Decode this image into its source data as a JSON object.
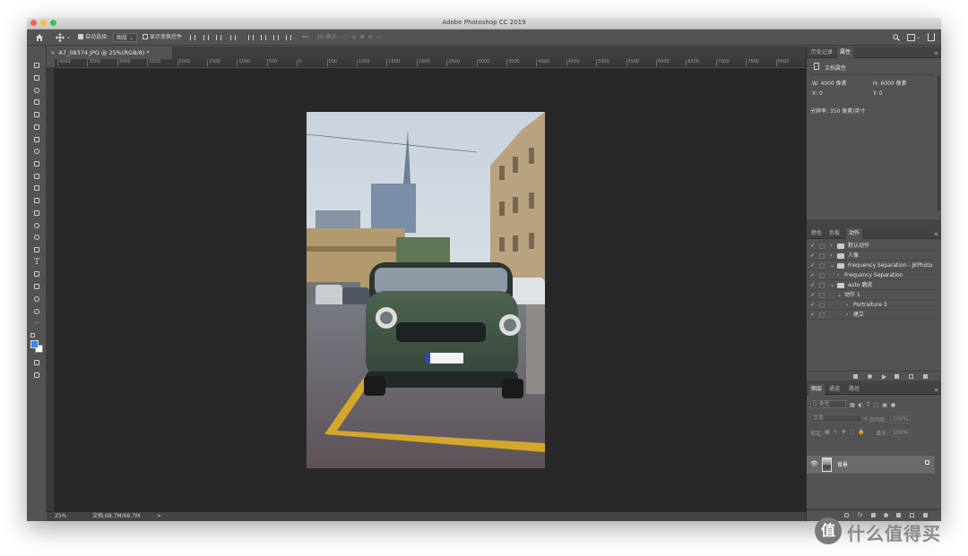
{
  "window": {
    "title": "Adobe Photoshop CC 2019"
  },
  "options_bar": {
    "auto_select_label": "自动选择:",
    "auto_select_value": "图层",
    "show_transform_label": "显示变换控件",
    "mode_3d_label": "3D 模式:"
  },
  "document": {
    "tab_label": "A7_08374.JPG @ 25%(RGB/8) *"
  },
  "rulers": {
    "top_ticks": [
      "4000",
      "3500",
      "3000",
      "2500",
      "2000",
      "1500",
      "1000",
      "500",
      "0",
      "500",
      "1000",
      "1500",
      "2000",
      "2500",
      "3000",
      "3500",
      "4000",
      "4500",
      "5000",
      "5500",
      "6000",
      "6500",
      "7000",
      "7500",
      "8000"
    ]
  },
  "status": {
    "zoom": "25%",
    "doc_info": "文档:68.7M/68.7M",
    "arrow": ">"
  },
  "panels": {
    "top": {
      "tabs": [
        "历史记录",
        "属性"
      ],
      "active_tab": "属性",
      "section_label": "文档属性",
      "width": "W: 4000 像素",
      "height": "H: 6000 像素",
      "x": "X: 0",
      "y": "Y: 0",
      "resolution": "分辨率: 350 像素/英寸"
    },
    "middle": {
      "tabs": [
        "颜色",
        "色板",
        "动作"
      ],
      "active_tab": "动作",
      "actions": [
        {
          "label": "默认动作",
          "type": "set",
          "expanded": false
        },
        {
          "label": "人像",
          "type": "set",
          "expanded": false
        },
        {
          "label": "Frequency Separation - JKPhoto",
          "type": "set",
          "expanded": true
        },
        {
          "label": "Frequency Separation",
          "type": "action",
          "expanded": false
        },
        {
          "label": "auto 磨皮",
          "type": "set",
          "expanded": true
        },
        {
          "label": "动作 1",
          "type": "action",
          "expanded": true
        },
        {
          "label": "Portraiture 3",
          "type": "step",
          "expanded": false
        },
        {
          "label": "建立",
          "type": "step",
          "expanded": false
        }
      ]
    },
    "bottom": {
      "tabs": [
        "图层",
        "通道",
        "路径"
      ],
      "active_tab": "图层",
      "filter_label": "Q 类型",
      "blend_mode": "正常",
      "opacity_label": "不透明度:",
      "opacity_value": "100%",
      "lock_label": "锁定:",
      "fill_label": "填充:",
      "fill_value": "100%",
      "layers": [
        {
          "name": "背景",
          "visible": true,
          "locked": true
        }
      ]
    }
  },
  "watermark": {
    "text": "什么值得买",
    "badge": "值"
  }
}
